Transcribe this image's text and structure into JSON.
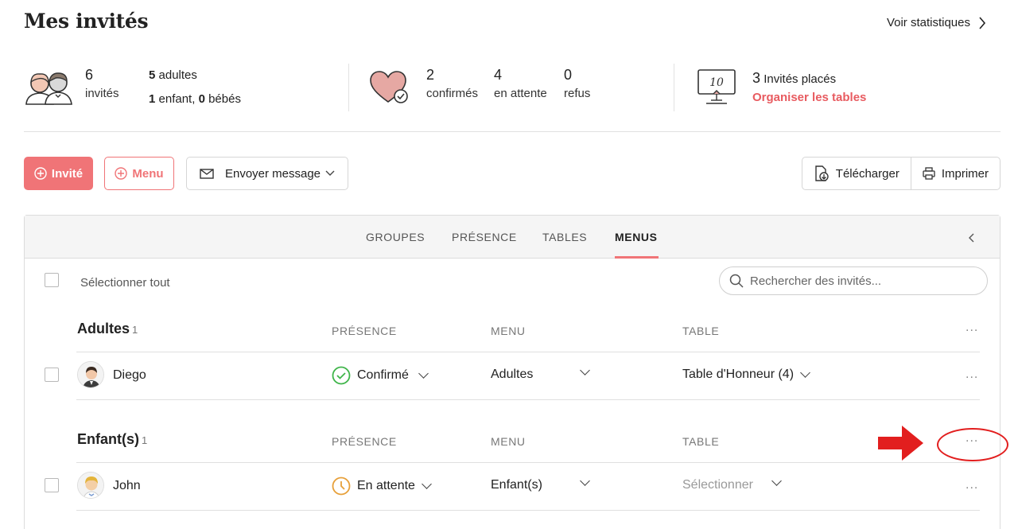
{
  "header": {
    "title": "Mes invités",
    "stats_link": "Voir statistiques"
  },
  "summary": {
    "guests": {
      "count": "6",
      "label": "invités"
    },
    "adults": {
      "count": "5",
      "label": "adultes"
    },
    "children": {
      "count": "1",
      "label": "enfant,",
      "babies_count": "0",
      "babies_label": "bébés"
    },
    "confirmed": {
      "count": "2",
      "label": "confirmés"
    },
    "pending": {
      "count": "4",
      "label": "en attente"
    },
    "refused": {
      "count": "0",
      "label": "refus"
    },
    "placed": {
      "count": "3",
      "label": "Invités placés"
    },
    "organize_link": "Organiser les tables",
    "table_icon_number": "10"
  },
  "toolbar": {
    "add_guest": "Invité",
    "add_menu": "Menu",
    "send_message": "Envoyer message",
    "download": "Télécharger",
    "print": "Imprimer"
  },
  "tabs": [
    {
      "label": "GROUPES",
      "active": false
    },
    {
      "label": "PRÉSENCE",
      "active": false
    },
    {
      "label": "TABLES",
      "active": false
    },
    {
      "label": "MENUS",
      "active": true
    }
  ],
  "list": {
    "select_all": "Sélectionner tout",
    "search_placeholder": "Rechercher des invités...",
    "groups": [
      {
        "title": "Adultes",
        "count": "1",
        "columns": [
          "PRÉSENCE",
          "MENU",
          "TABLE"
        ],
        "rows": [
          {
            "name": "Diego",
            "presence": "Confirmé",
            "menu": "Adultes",
            "table": "Table d'Honneur (4)"
          }
        ]
      },
      {
        "title": "Enfant(s)",
        "count": "1",
        "columns": [
          "PRÉSENCE",
          "MENU",
          "TABLE"
        ],
        "rows": [
          {
            "name": "John",
            "presence": "En attente",
            "menu": "Enfant(s)",
            "table": "Sélectionner"
          }
        ]
      }
    ],
    "more_label": "..."
  },
  "colors": {
    "accent": "#f07477",
    "confirmed": "#3fb54a",
    "pending": "#e7a03a",
    "annotation": "#e21e1e"
  }
}
